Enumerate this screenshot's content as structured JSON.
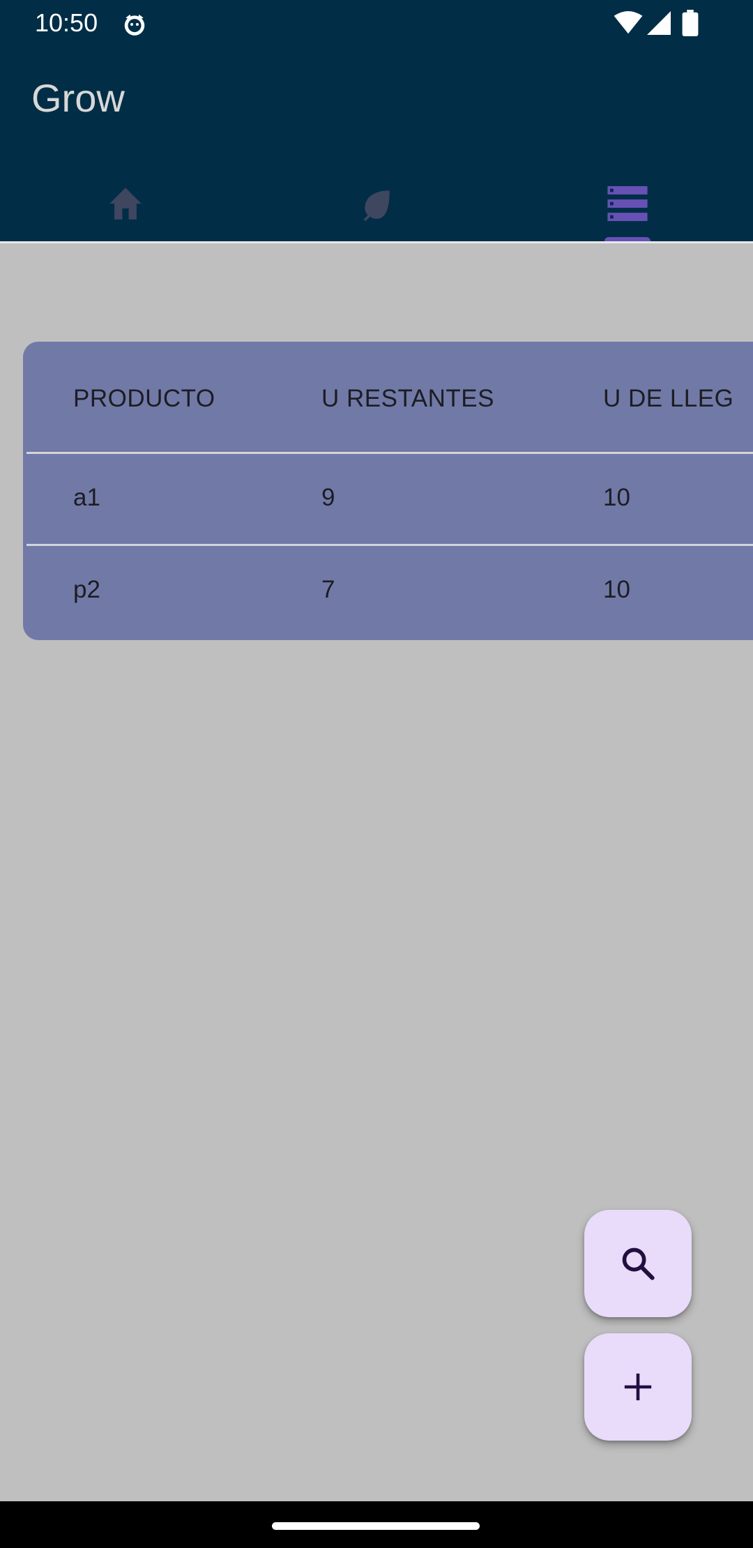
{
  "status_bar": {
    "time": "10:50",
    "icons": [
      "cat-face-icon",
      "wifi-icon",
      "signal-icon",
      "battery-icon"
    ]
  },
  "app_bar": {
    "title": "Grow",
    "tabs": [
      {
        "icon": "home-icon",
        "selected": false
      },
      {
        "icon": "leaf-icon",
        "selected": false
      },
      {
        "icon": "storage-icon",
        "selected": true
      }
    ]
  },
  "table": {
    "columns": [
      "PRODUCTO",
      "U RESTANTES",
      "U DE LLEG"
    ],
    "rows": [
      [
        "a1",
        "9",
        "10"
      ],
      [
        "p2",
        "7",
        "10"
      ]
    ]
  },
  "fabs": [
    {
      "icon": "search-icon"
    },
    {
      "icon": "add-icon"
    }
  ],
  "colors": {
    "app_bar": "#012e46",
    "background": "#bfbfbf",
    "table": "#717aa6",
    "fab": "#e8dcfa",
    "tab_selected": "#6751b5",
    "tab_unselected": "#3e4660"
  }
}
